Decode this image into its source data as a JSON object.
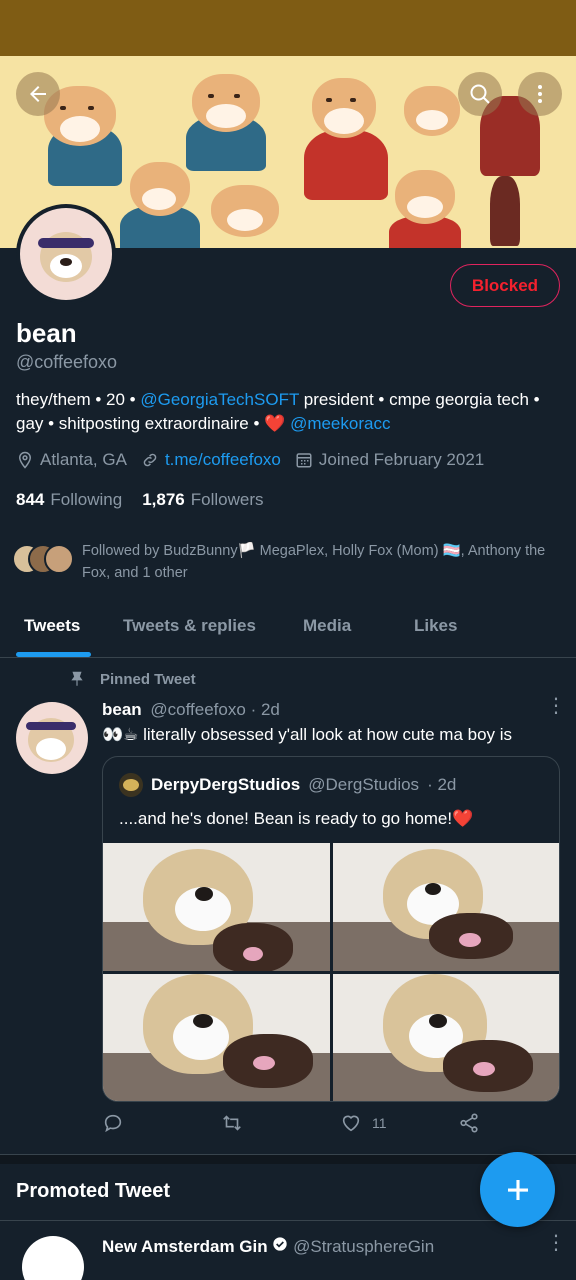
{
  "header": {
    "back_icon": "arrow-left-icon",
    "search_icon": "search-icon",
    "more_icon": "more-vertical-icon"
  },
  "profile": {
    "name": "bean",
    "handle": "@coffeefoxo",
    "blocked_label": "Blocked",
    "bio_prefix": "they/them • 20 • ",
    "bio_link1": "@GeorgiaTechSOFT",
    "bio_middle": " president • cmpe georgia tech • gay • shitposting extraordinaire • ",
    "bio_heart": "❤️",
    "bio_link2": "@meekoracc",
    "location": "Atlanta, GA",
    "website": "t.me/coffeefoxo",
    "joined": "Joined February 2021",
    "following_count": "844",
    "following_label": "Following",
    "followers_count": "1,876",
    "followers_label": "Followers",
    "followed_by_text": "Followed by BudzBunny🏳️ MegaPlex, Holly Fox (Mom) 🏳️‍⚧️, Anthony the Fox, and 1 other"
  },
  "tabs": [
    {
      "label": "Tweets",
      "active": true
    },
    {
      "label": "Tweets & replies",
      "active": false
    },
    {
      "label": "Media",
      "active": false
    },
    {
      "label": "Likes",
      "active": false
    }
  ],
  "pinned_tweet": {
    "pinned_label": "Pinned Tweet",
    "author_name": "bean",
    "author_handle": "@coffeefoxo",
    "time": "· 2d",
    "text": "👀☕ literally obsessed y'all look at how cute ma boy is",
    "quote": {
      "author_name": "DerpyDergStudios",
      "author_handle": "@DergStudios",
      "time": "· 2d",
      "text": "....and he's done! Bean is ready to go home!❤️"
    },
    "like_count": "11"
  },
  "promoted": {
    "section_label": "Promoted Tweet",
    "author_name": "New Amsterdam Gin",
    "author_handle": "@StratusphereGin"
  },
  "colors": {
    "accent": "#1d9bf0",
    "blocked": "#f4212e",
    "background": "#15202b",
    "banner": "#f6e3a3"
  }
}
